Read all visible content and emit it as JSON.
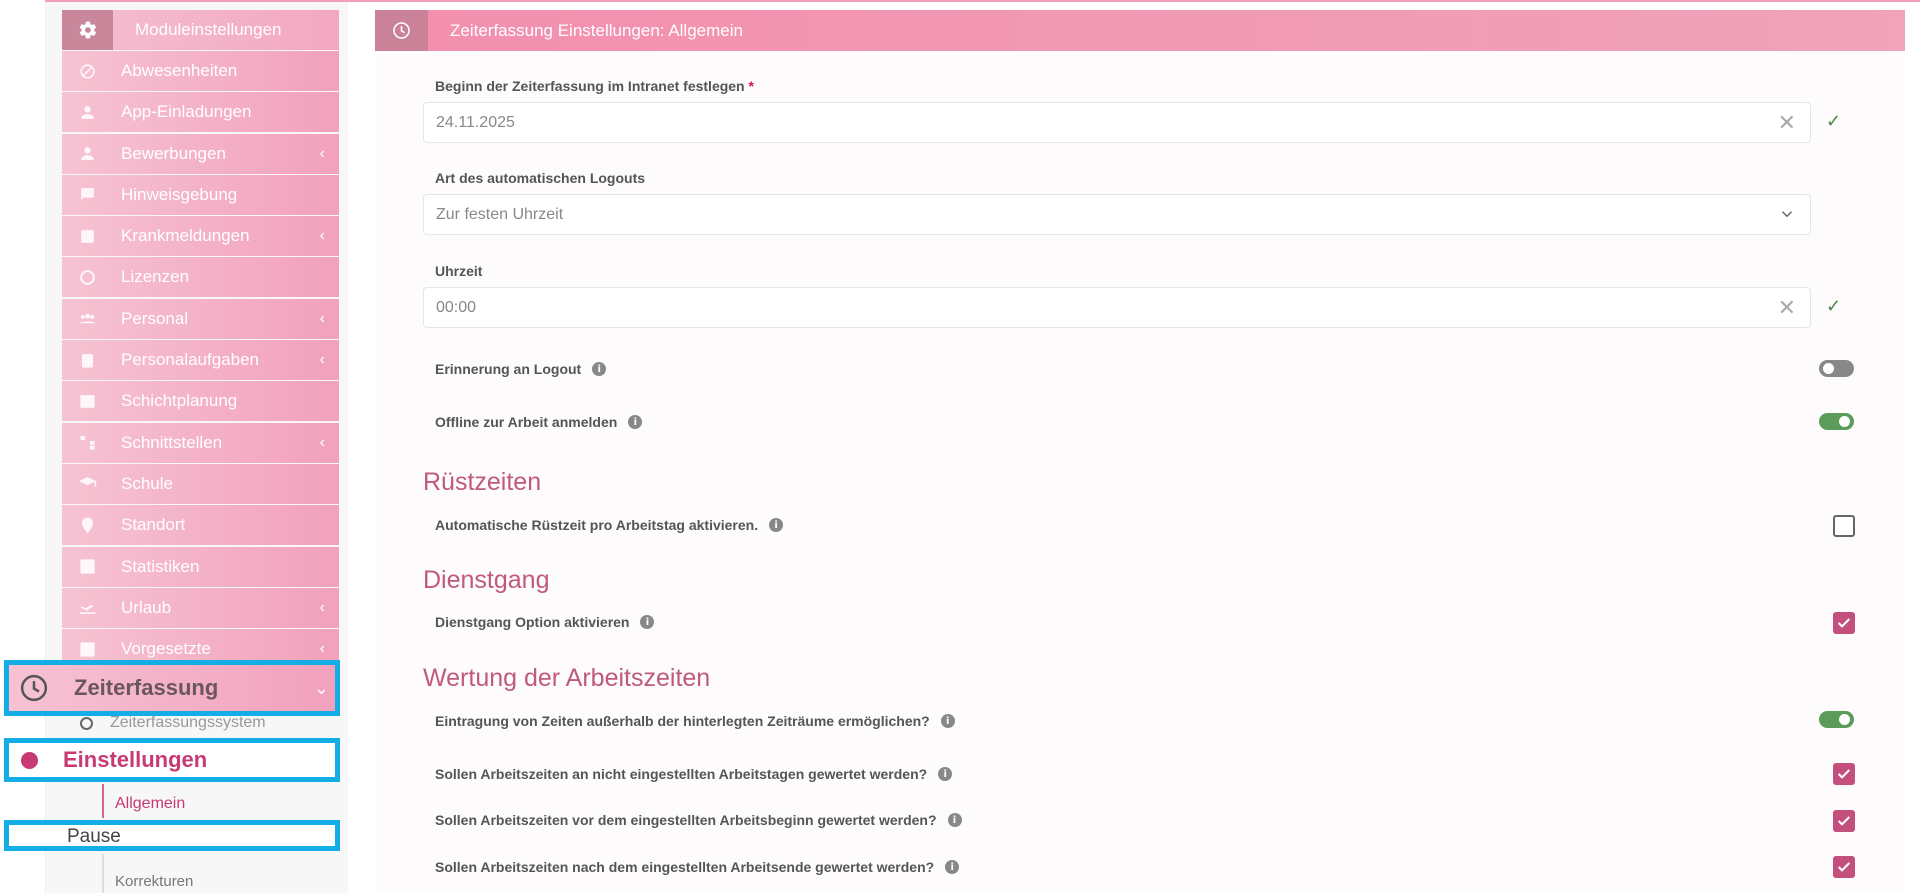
{
  "sidebar": {
    "header_label": "Moduleinstellungen",
    "items": [
      {
        "label": "Abwesenheiten",
        "icon": "block-icon",
        "has_chevron": false
      },
      {
        "label": "App-Einladungen",
        "icon": "person-icon",
        "has_chevron": false
      },
      {
        "label": "Bewerbungen",
        "icon": "person-icon",
        "has_chevron": true
      },
      {
        "label": "Hinweisgebung",
        "icon": "feedback-icon",
        "has_chevron": false
      },
      {
        "label": "Krankmeldungen",
        "icon": "medical-icon",
        "has_chevron": true
      },
      {
        "label": "Lizenzen",
        "icon": "circle-progress-icon",
        "has_chevron": false
      },
      {
        "label": "Personal",
        "icon": "group-icon",
        "has_chevron": true
      },
      {
        "label": "Personalaufgaben",
        "icon": "task-icon",
        "has_chevron": true
      },
      {
        "label": "Schichtplanung",
        "icon": "table-icon",
        "has_chevron": false
      },
      {
        "label": "Schnittstellen",
        "icon": "hierarchy-icon",
        "has_chevron": true
      },
      {
        "label": "Schule",
        "icon": "school-icon",
        "has_chevron": false
      },
      {
        "label": "Standort",
        "icon": "location-icon",
        "has_chevron": false
      },
      {
        "label": "Statistiken",
        "icon": "chart-icon",
        "has_chevron": false
      },
      {
        "label": "Urlaub",
        "icon": "flight-icon",
        "has_chevron": true
      },
      {
        "label": "Vorgesetzte",
        "icon": "chart-icon",
        "has_chevron": true
      }
    ],
    "chevron": "‹",
    "zeiterfassung_label": "Zeiterfassung",
    "zeiterfassungssystem_label": "Zeiterfassungssystem",
    "einstellungen_label": "Einstellungen",
    "allgemein_label": "Allgemein",
    "pause_label": "Pause",
    "korrekturen_label": "Korrekturen"
  },
  "main": {
    "title": "Zeiterfassung Einstellungen: Allgemein",
    "start_label": "Beginn der Zeiterfassung im Intranet festlegen",
    "start_required": "*",
    "start_value": "24.11.2025",
    "logout_type_label": "Art des automatischen Logouts",
    "logout_type_value": "Zur festen Uhrzeit",
    "time_label": "Uhrzeit",
    "time_value": "00:00",
    "clear_glyph": "✕",
    "ok_glyph": "✓",
    "info_glyph": "i",
    "reminder_label": "Erinnerung an Logout",
    "reminder_on": false,
    "offline_label": "Offline zur Arbeit anmelden",
    "offline_on": true,
    "section_ruest": "Rüstzeiten",
    "ruest_label": "Automatische Rüstzeit pro Arbeitstag aktivieren.",
    "ruest_checked": false,
    "section_dienst": "Dienstgang",
    "dienst_label": "Dienstgang Option aktivieren",
    "dienst_checked": true,
    "section_wertung": "Wertung der Arbeitszeiten",
    "w1_label": "Eintragung von Zeiten außerhalb der hinterlegten Zeiträume ermöglichen?",
    "w1_on": true,
    "w2_label": "Sollen Arbeitszeiten an nicht eingestellten Arbeitstagen gewertet werden?",
    "w2_checked": true,
    "w3_label": "Sollen Arbeitszeiten vor dem eingestellten Arbeitsbeginn gewertet werden?",
    "w3_checked": true,
    "w4_label": "Sollen Arbeitszeiten nach dem eingestellten Arbeitsende gewertet werden?",
    "w4_checked": true
  },
  "colors": {
    "accent": "#c73a74",
    "highlight_box": "#13aee5",
    "toggle_on": "#5b9c5b",
    "toggle_off": "#888888"
  }
}
